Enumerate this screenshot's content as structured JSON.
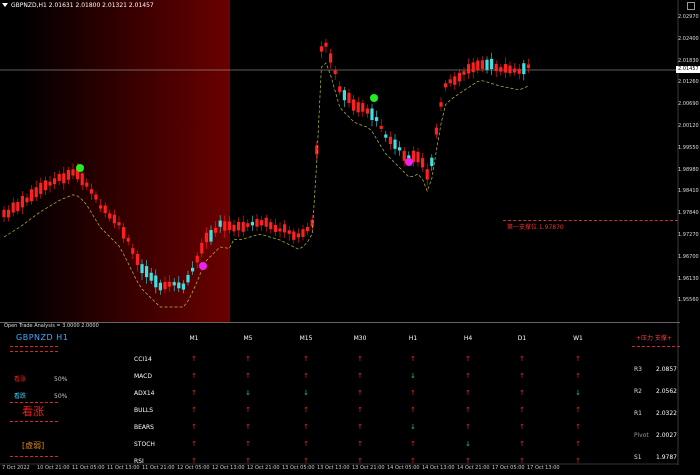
{
  "header": {
    "symbol_line": "GBPNZD,H1  2.01631 2.01800 2.01321 2.01457"
  },
  "price_axis": [
    "2.02970",
    "2.02400",
    "2.01830",
    "2.01260",
    "2.00690",
    "2.00120",
    "1.99550",
    "1.98980",
    "1.98410",
    "1.97840",
    "1.97270",
    "1.96700",
    "1.96130",
    "1.95560"
  ],
  "current_price": "2.01457",
  "time_axis": [
    "7 Oct 2022",
    "10 Oct 21:00",
    "11 Oct 05:00",
    "11 Oct 13:00",
    "11 Oct 21:00",
    "12 Oct 05:00",
    "12 Oct 13:00",
    "12 Oct 21:00",
    "13 Oct 05:00",
    "13 Oct 13:00",
    "13 Oct 21:00",
    "14 Oct 05:00",
    "14 Oct 13:00",
    "14 Oct 21:00",
    "17 Oct 05:00",
    "17 Oct 13:00"
  ],
  "resistance": {
    "text": "第一支撑位 1.97870",
    "color": "#cc3333"
  },
  "panel": {
    "title": "Open Trade Analysis = 3.0000 2.0000",
    "symbol": "GBPNZD  H1",
    "bull_label": "看涨",
    "bull_pct": "50%",
    "bear_label": "看跌",
    "bear_pct": "50%",
    "signal": "看涨",
    "strength": "[虚弱]",
    "timeframes": [
      "M1",
      "M5",
      "M15",
      "M30",
      "H1",
      "H4",
      "D1",
      "W1"
    ],
    "indicators": [
      {
        "name": "CCI14",
        "dirs": [
          "up",
          "up",
          "up",
          "up",
          "up",
          "up",
          "up",
          "up"
        ]
      },
      {
        "name": "MACD",
        "dirs": [
          "up",
          "up",
          "up",
          "up",
          "dn",
          "up",
          "up",
          "up"
        ]
      },
      {
        "name": "ADX14",
        "dirs": [
          "up",
          "dn",
          "dn",
          "up",
          "up",
          "up",
          "up",
          "dn"
        ]
      },
      {
        "name": "BULLS",
        "dirs": [
          "up",
          "up",
          "up",
          "up",
          "up",
          "up",
          "up",
          "up"
        ]
      },
      {
        "name": "BEARS",
        "dirs": [
          "up",
          "up",
          "up",
          "up",
          "dn",
          "up",
          "up",
          "up"
        ]
      },
      {
        "name": "STOCH",
        "dirs": [
          "up",
          "up",
          "up",
          "up",
          "up",
          "dn",
          "up",
          "up"
        ]
      },
      {
        "name": "RSI",
        "dirs": [
          "up",
          "up",
          "up",
          "up",
          "up",
          "up",
          "up",
          "up"
        ]
      }
    ],
    "pivot": {
      "title": "+压力 支撑+",
      "rows": [
        {
          "label": "R3",
          "value": "2.0857"
        },
        {
          "label": "R2",
          "value": "2.0562"
        },
        {
          "label": "R1",
          "value": "2.0322"
        },
        {
          "label": "Pivot",
          "value": "2.0027"
        },
        {
          "label": "S1",
          "value": "1.9787"
        }
      ]
    }
  },
  "colors": {
    "bull_candle": "#ff2020",
    "bear_candle": "#40e0e0",
    "highlight_zone": "#7a0000",
    "signal_buy": "#22ee22",
    "signal_sell": "#ee22ee"
  }
}
